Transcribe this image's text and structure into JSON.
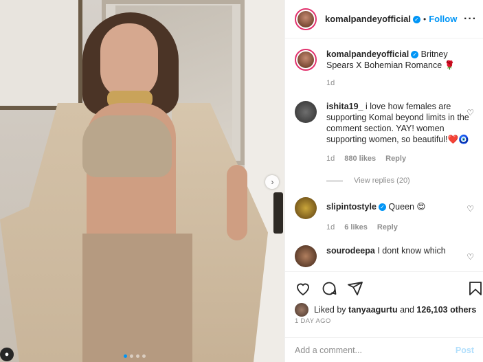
{
  "post": {
    "username": "komalpandeyofficial",
    "follow_label": "Follow",
    "caption": "Britney Spears X Bohemian Romance 🌹",
    "caption_age": "1d"
  },
  "comments": [
    {
      "username": "ishita19_",
      "text": "i love how females are supporting Komal beyond limits in the comment section. YAY! women supporting women, so beautiful!❤️🧿",
      "age": "1d",
      "likes": "880 likes",
      "reply_label": "Reply",
      "view_replies": "View replies (20)"
    },
    {
      "username": "slipintostyle",
      "text": "Queen 😍",
      "age": "1d",
      "likes": "6 likes",
      "reply_label": "Reply"
    },
    {
      "username": "sourodeepa",
      "text": "I dont know which"
    }
  ],
  "likes_bar": {
    "liked_by_prefix": "Liked by",
    "liked_by_user": "tanyaagurtu",
    "and_text": "and",
    "others": "126,103 others",
    "time_ago": "1 DAY AGO"
  },
  "comment_box": {
    "placeholder": "Add a comment...",
    "post_label": "Post"
  },
  "colors": {
    "accent": "#0095f6",
    "post_disabled": "#b2dffc"
  },
  "icons": [
    "heart-icon",
    "comment-icon",
    "share-icon",
    "bookmark-icon",
    "more-icon",
    "chevron-right-icon",
    "user-tag-icon",
    "verified-icon"
  ],
  "carousel": {
    "current": 1,
    "total": 4
  }
}
